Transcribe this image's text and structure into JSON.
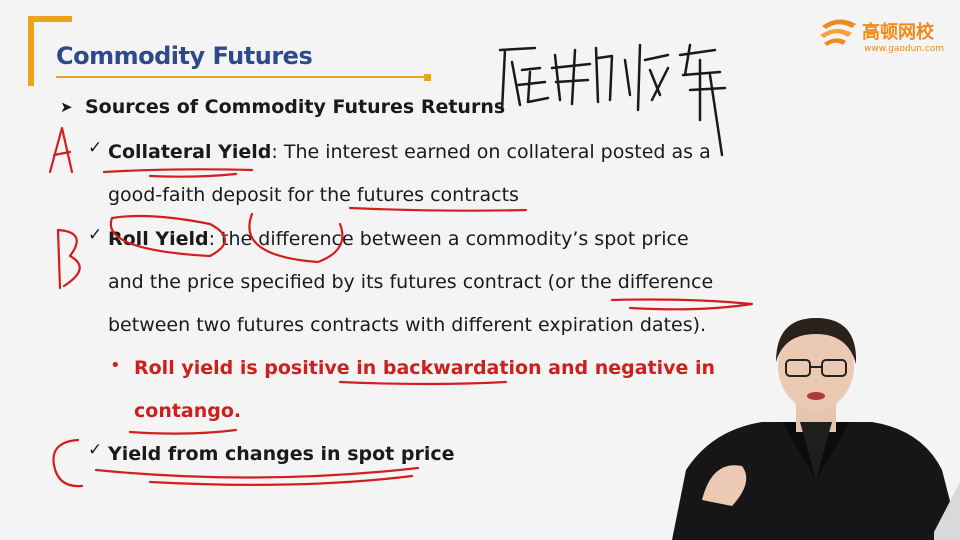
{
  "slide": {
    "title": "Commodity Futures",
    "heading": "Sources of Commodity Futures Returns",
    "items": [
      {
        "term": "Collateral Yield",
        "line1_rest": ": The interest earned on collateral posted as a",
        "line2": "good-faith deposit for the futures contracts"
      },
      {
        "term": "Roll Yield",
        "line1_rest": ": the difference between a commodity’s spot price",
        "line2": "and the price specified by its futures contract (or the difference",
        "line3": "between two futures contracts with different expiration dates)."
      },
      {
        "term": "Yield from changes in spot price"
      }
    ],
    "sub_bullet_line1": "Roll yield is positive in backwardation and negative in",
    "sub_bullet_line2": "contango."
  },
  "logo": {
    "name": "高顿网校",
    "url": "www.gaodun.com",
    "color": "#f08a1a"
  },
  "annotations": {
    "handwriting": "展期收益",
    "letters": [
      "A",
      "B",
      "C"
    ],
    "ink_color": "#d21e1e"
  },
  "icons": {
    "heading_marker": "arrowhead-bullet-icon",
    "item_marker": "checkmark-icon",
    "sub_marker": "red-dot-bullet"
  }
}
